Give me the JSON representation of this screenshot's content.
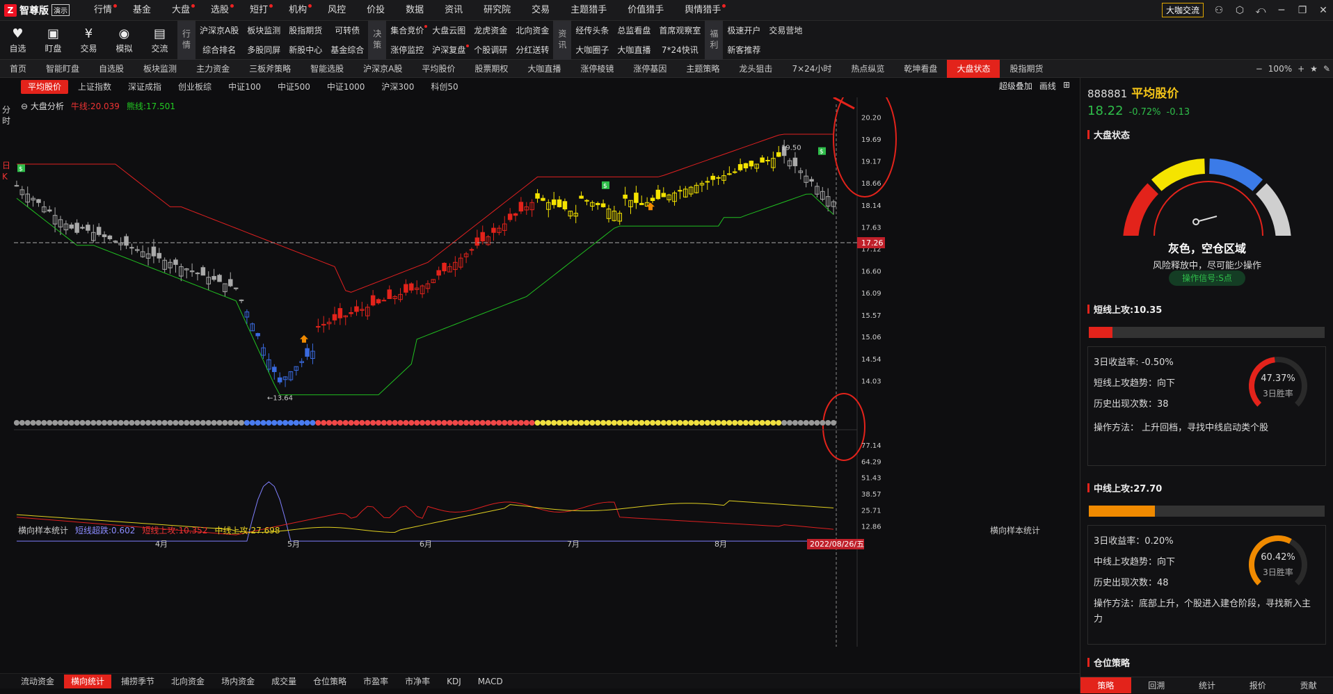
{
  "app": {
    "logo_mark": "Z",
    "name": "智尊版",
    "demo": "演示"
  },
  "menu": [
    {
      "label": "行情",
      "dot": true
    },
    {
      "label": "基金",
      "dot": false
    },
    {
      "label": "大盘",
      "dot": true
    },
    {
      "label": "选股",
      "dot": true
    },
    {
      "label": "短打",
      "dot": true
    },
    {
      "label": "机构",
      "dot": true
    },
    {
      "label": "风控",
      "dot": false
    },
    {
      "label": "价投",
      "dot": false
    },
    {
      "label": "数据",
      "dot": false
    },
    {
      "label": "资讯",
      "dot": false
    },
    {
      "label": "研究院",
      "dot": false
    },
    {
      "label": "交易",
      "dot": false
    },
    {
      "label": "主题猎手",
      "dot": false
    },
    {
      "label": "价值猎手",
      "dot": false
    },
    {
      "label": "舆情猎手",
      "dot": true
    }
  ],
  "topright": {
    "daka": "大咖交流"
  },
  "toolbar": {
    "big": [
      {
        "label": "自选",
        "icon": "heart-icon",
        "glyph": "♥"
      },
      {
        "label": "盯盘",
        "icon": "monitor-icon",
        "glyph": "▣"
      },
      {
        "label": "交易",
        "icon": "yen-icon",
        "glyph": "¥"
      },
      {
        "label": "模拟",
        "icon": "gamepad-icon",
        "glyph": "◉"
      },
      {
        "label": "交流",
        "icon": "chat-icon",
        "glyph": "▤"
      }
    ],
    "groups": [
      {
        "label": "行情",
        "items": [
          {
            "t": "沪深京A股"
          },
          {
            "t": "综合排名"
          },
          {
            "t": "板块监测"
          },
          {
            "t": "多股同屏"
          },
          {
            "t": "股指期货"
          },
          {
            "t": "新股中心"
          },
          {
            "t": "可转债"
          },
          {
            "t": "基金综合"
          }
        ]
      },
      {
        "label": "决策",
        "items": [
          {
            "t": "集合竞价",
            "dot": true
          },
          {
            "t": "涨停监控"
          },
          {
            "t": "大盘云图"
          },
          {
            "t": "沪深复盘",
            "dot": true
          },
          {
            "t": "龙虎资金"
          },
          {
            "t": "个股调研"
          },
          {
            "t": "北向资金"
          },
          {
            "t": "分红送转"
          }
        ]
      },
      {
        "label": "资讯",
        "items": [
          {
            "t": "经传头条"
          },
          {
            "t": "大咖圈子"
          },
          {
            "t": "总监看盘"
          },
          {
            "t": "大咖直播"
          },
          {
            "t": "首席观察室"
          },
          {
            "t": "7*24快讯"
          }
        ]
      },
      {
        "label": "福利",
        "items": [
          {
            "t": "极速开户"
          },
          {
            "t": "新客推荐"
          },
          {
            "t": "交易营地"
          }
        ]
      }
    ]
  },
  "navtabs": [
    "首页",
    "智能盯盘",
    "自选股",
    "板块监测",
    "主力资金",
    "三板斧策略",
    "智能选股",
    "沪深京A股",
    "平均股价",
    "股票期权",
    "大咖直播",
    "涨停棱镜",
    "涨停基因",
    "主题策略",
    "龙头狙击",
    "7×24小时",
    "热点纵览",
    "乾坤看盘",
    "大盘状态",
    "股指期货"
  ],
  "navtabs_active": 18,
  "navright": {
    "zoom": "100%"
  },
  "indextabs": [
    "平均股价",
    "上证指数",
    "深证成指",
    "创业板综",
    "中证100",
    "中证500",
    "中证1000",
    "沪深300",
    "科创50"
  ],
  "indextabs_active": 0,
  "idxright": {
    "overlay": "超级叠加",
    "draw": "画线"
  },
  "sidetabs": [
    "分",
    "时",
    "日",
    "K"
  ],
  "chart_info": {
    "label": "大盘分析",
    "bull": "牛线:20.039",
    "bear": "熊线:17.501"
  },
  "chart_labels": {
    "high": "19.50",
    "low": "13.64",
    "crosshair_price": "17.26",
    "date": "2022/08/26/五"
  },
  "legend2": {
    "title": "横向样本统计",
    "s1": "短线超跌:0.602",
    "s2": "短线上攻:10.352",
    "s3": "中线上攻:27.698",
    "right": "横向样本统计"
  },
  "bottomtabs": [
    "流动资金",
    "横向统计",
    "捕捞季节",
    "北向资金",
    "场内资金",
    "成交量",
    "仓位策略",
    "市盈率",
    "市净率",
    "KDJ",
    "MACD"
  ],
  "bottomtabs_active": 1,
  "chart_data": [
    {
      "type": "line",
      "title": "大盘分析",
      "y_ticks": [
        20.2,
        19.69,
        19.17,
        18.66,
        18.14,
        17.63,
        17.12,
        16.6,
        16.09,
        15.57,
        15.06,
        14.54,
        14.03
      ],
      "x_ticks": [
        "4月",
        "5月",
        "6月",
        "7月",
        "8月"
      ],
      "series": [
        {
          "name": "牛线",
          "value": 20.039,
          "color": "#e02020"
        },
        {
          "name": "熊线",
          "value": 17.501,
          "color": "#20c020"
        }
      ],
      "annotations": {
        "high": 19.5,
        "low": 13.64,
        "crosshair": 17.26
      }
    },
    {
      "type": "line",
      "title": "横向样本统计",
      "y_ticks": [
        77.14,
        64.29,
        51.43,
        38.57,
        25.71,
        12.86
      ],
      "series": [
        {
          "name": "短线超跌",
          "value": 0.602,
          "color": "#8080ff"
        },
        {
          "name": "短线上攻",
          "value": 10.352,
          "color": "#e02020"
        },
        {
          "name": "中线上攻",
          "value": 27.698,
          "color": "#e0d020"
        }
      ]
    }
  ],
  "panel": {
    "code": "888881",
    "name": "平均股价",
    "price": "18.22",
    "pct": "-0.72%",
    "chg": "-0.13",
    "state_title": "大盘状态",
    "gauge_text": "灰色，空仓区域",
    "gauge_sub": "风险释放中，尽可能少操作",
    "signal": "操作信号:S点",
    "short": {
      "title": "短线上攻:10.35",
      "fill": 0.1,
      "color": "#e3231b",
      "ret": "3日收益率: -0.50%",
      "trend": "短线上攻趋势：向下",
      "count": "历史出现次数：38",
      "method": "操作方法：  上升回档，寻找中线启动类个股",
      "win": "47.37%",
      "winlabel": "3日胜率",
      "winv": 0.4737
    },
    "mid": {
      "title": "中线上攻:27.70",
      "fill": 0.28,
      "color": "#f08a00",
      "ret": "3日收益率：0.20%",
      "trend": "中线上攻趋势：向下",
      "count": "历史出现次数：48",
      "method": "操作方法：底部上升，个股进入建仓阶段，寻找新入主力",
      "win": "60.42%",
      "winlabel": "3日胜率",
      "winv": 0.6042
    },
    "pos_title": "仓位策略",
    "tabs": [
      "策略",
      "回溯",
      "统计",
      "报价",
      "贡献"
    ],
    "tabs_active": 0
  }
}
